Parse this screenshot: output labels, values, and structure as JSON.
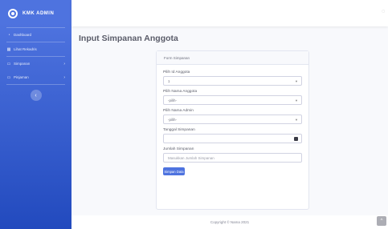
{
  "brand": {
    "name": "KMK ADMIN",
    "logo_icon": "laugh-wink-icon"
  },
  "sidebar": {
    "items": [
      {
        "label": "Dashboard",
        "icon": "tachometer-icon",
        "has_submenu": false
      },
      {
        "label": "Lihat Rekadris",
        "icon": "table-icon",
        "has_submenu": false
      },
      {
        "label": "Simpanan",
        "icon": "folder-icon",
        "has_submenu": true
      },
      {
        "label": "Pinjaman",
        "icon": "folder-icon",
        "has_submenu": true
      }
    ],
    "toggle_icon": "chevron-left-icon"
  },
  "topbar": {
    "user_icon": "user-icon"
  },
  "page": {
    "title": "Input Simpanan Anggota"
  },
  "form": {
    "header": "Form Simpanan",
    "fields": {
      "id_anggota": {
        "label": "Pilih Id Anggota",
        "value": "1"
      },
      "nama_anggota": {
        "label": "Pilih Nama Anggota",
        "value": "-pilih-"
      },
      "nama_admin": {
        "label": "Pilih Nama Admin",
        "value": "-pilih-"
      },
      "tanggal": {
        "label": "Tanggal Simpanan",
        "value": ""
      },
      "jumlah": {
        "label": "Jumlah Simpanan",
        "placeholder": "Masukkan Jumlah Simpanan"
      }
    },
    "submit_label": "Simpan Data"
  },
  "footer": {
    "text": "Copyright © Nama 2021"
  },
  "colors": {
    "primary": "#4e73df",
    "sidebar_dark": "#224abe",
    "background": "#f8f9fc"
  }
}
